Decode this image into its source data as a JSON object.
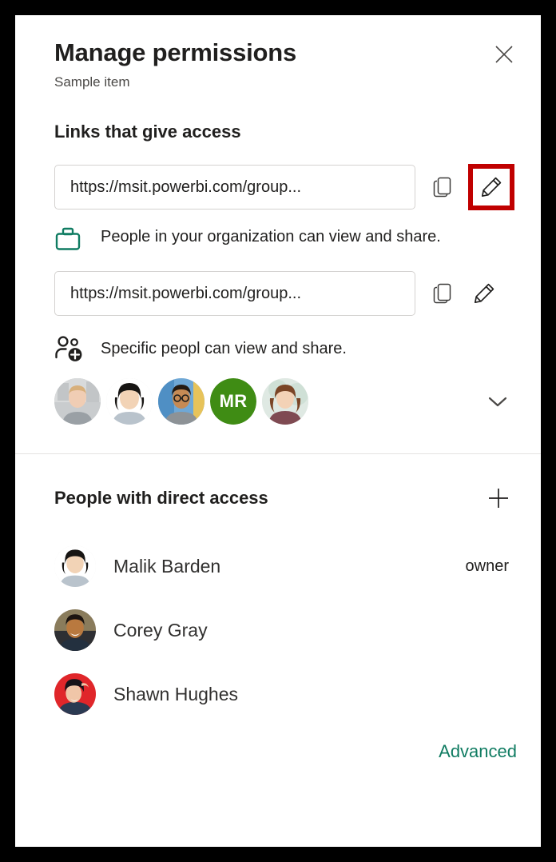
{
  "dialog": {
    "title": "Manage permissions",
    "subtitle": "Sample item",
    "close_icon": "close-icon"
  },
  "links_section": {
    "heading": "Links that give access",
    "links": [
      {
        "url": "https://msit.powerbi.com/group...",
        "description": "People in your organization can view and share.",
        "access_icon": "briefcase-icon",
        "access_icon_color": "#107c62",
        "copy_icon": "copy-icon",
        "edit_icon": "pencil-icon",
        "edit_highlighted": true
      },
      {
        "url": "https://msit.powerbi.com/group...",
        "description": "Specific peopl can view and share.",
        "access_icon": "people-add-icon",
        "access_icon_color": "#201f1e",
        "copy_icon": "copy-icon",
        "edit_icon": "pencil-icon",
        "edit_highlighted": false
      }
    ],
    "avatars": [
      {
        "type": "photo",
        "variant": "woman-glasses-gray"
      },
      {
        "type": "photo",
        "variant": "woman-dark-hair"
      },
      {
        "type": "photo",
        "variant": "man-glasses-blue"
      },
      {
        "type": "initials",
        "initials": "MR",
        "color": "#3f8c14"
      },
      {
        "type": "photo",
        "variant": "woman-red-hair"
      }
    ],
    "expand_icon": "chevron-down-icon"
  },
  "direct_access_section": {
    "heading": "People with direct access",
    "add_icon": "plus-icon",
    "people": [
      {
        "name": "Malik Barden",
        "role": "owner",
        "avatar_variant": "woman-dark-hair"
      },
      {
        "name": "Corey Gray",
        "role": "",
        "avatar_variant": "man-smiling"
      },
      {
        "name": "Shawn Hughes",
        "role": "",
        "avatar_variant": "woman-red-bg"
      }
    ]
  },
  "footer": {
    "advanced_label": "Advanced",
    "advanced_color": "#107c62"
  },
  "annotation": {
    "highlight_color": "#c00000",
    "target": "pencil-icon-first-link"
  }
}
